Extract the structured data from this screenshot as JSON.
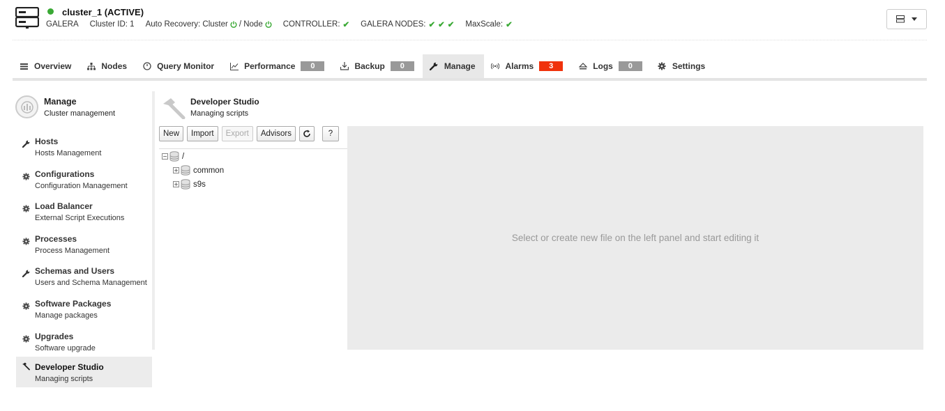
{
  "header": {
    "cluster_title": "cluster_1 (ACTIVE)",
    "cluster_type": "GALERA",
    "cluster_id": "Cluster ID: 1",
    "auto_recovery_label": "Auto Recovery: Cluster",
    "auto_recovery_node": "/ Node",
    "controller_label": "CONTROLLER:",
    "galera_nodes_label": "GALERA NODES:",
    "maxscale_label": "MaxScale:",
    "status_color": "#3aa935"
  },
  "tabs": [
    {
      "label": "Overview",
      "icon": "list-icon"
    },
    {
      "label": "Nodes",
      "icon": "sitemap-icon"
    },
    {
      "label": "Query Monitor",
      "icon": "dashboard-icon"
    },
    {
      "label": "Performance",
      "icon": "chart-icon",
      "badge": "0"
    },
    {
      "label": "Backup",
      "icon": "download-icon",
      "badge": "0"
    },
    {
      "label": "Manage",
      "icon": "wrench-icon",
      "active": true
    },
    {
      "label": "Alarms",
      "icon": "broadcast-icon",
      "badge": "3"
    },
    {
      "label": "Logs",
      "icon": "eject-icon",
      "badge": "0"
    },
    {
      "label": "Settings",
      "icon": "gear-icon"
    }
  ],
  "sidebar": {
    "title": "Manage",
    "subtitle": "Cluster management",
    "items": [
      {
        "label": "Hosts",
        "sub": "Hosts Management",
        "icon": "wrench-icon"
      },
      {
        "label": "Configurations",
        "sub": "Configuration Management",
        "icon": "gear-icon"
      },
      {
        "label": "Load Balancer",
        "sub": "External Script Executions",
        "icon": "gear-icon"
      },
      {
        "label": "Processes",
        "sub": "Process Management",
        "icon": "gear-icon"
      },
      {
        "label": "Schemas and Users",
        "sub": "Users and Schema Management",
        "icon": "wrench-icon"
      },
      {
        "label": "Software Packages",
        "sub": "Manage packages",
        "icon": "gear-icon"
      },
      {
        "label": "Upgrades",
        "sub": "Software upgrade",
        "icon": "gear-icon"
      },
      {
        "label": "Developer Studio",
        "sub": "Managing scripts",
        "icon": "hammer-icon",
        "active": true
      }
    ]
  },
  "content": {
    "title": "Developer Studio",
    "subtitle": "Managing scripts"
  },
  "toolbar": {
    "new": "New",
    "import": "Import",
    "export": "Export",
    "advisors": "Advisors",
    "help": "?"
  },
  "tree": {
    "root": "/",
    "children": [
      "common",
      "s9s"
    ]
  },
  "editor": {
    "placeholder": "Select or create new file on the left panel and start editing it"
  }
}
